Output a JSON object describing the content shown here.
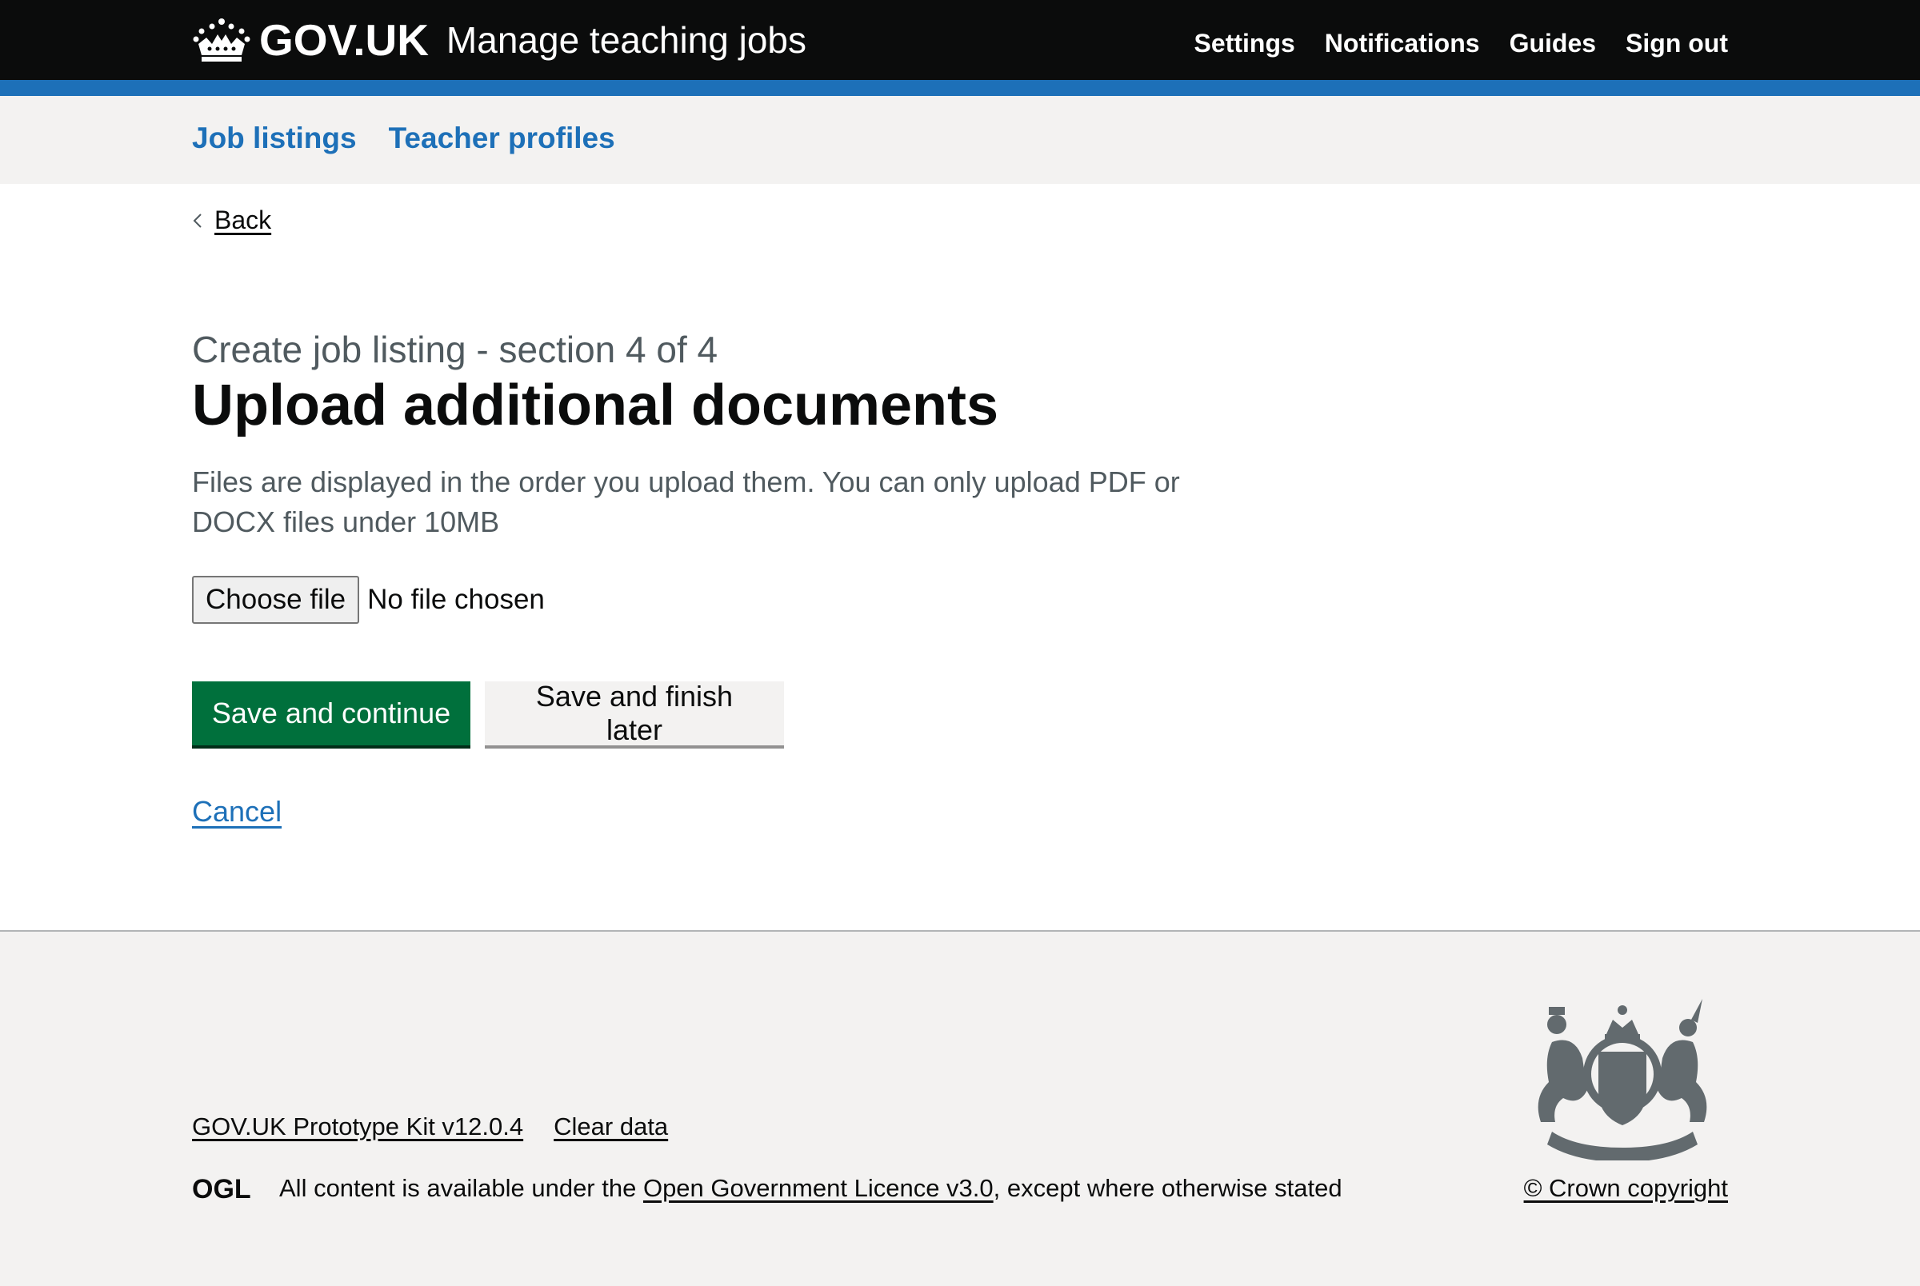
{
  "header": {
    "logo_text": "GOV.UK",
    "service_name": "Manage teaching jobs",
    "nav": [
      "Settings",
      "Notifications",
      "Guides",
      "Sign out"
    ]
  },
  "subnav": {
    "items": [
      "Job listings",
      "Teacher profiles"
    ]
  },
  "back_link": "Back",
  "form": {
    "caption": "Create job listing - section 4 of 4",
    "title": "Upload additional documents",
    "hint": "Files are displayed in the order you upload them. You can only upload PDF or DOCX files under 10MB",
    "file_button": "Choose file",
    "file_status": "No file chosen",
    "primary_button": "Save and continue",
    "secondary_button": "Save and finish later",
    "cancel_link": "Cancel"
  },
  "footer": {
    "links": [
      "GOV.UK Prototype Kit v12.0.4",
      "Clear data"
    ],
    "licence_prefix": "All content is available under the ",
    "licence_link": "Open Government Licence v3.0",
    "licence_suffix": ", except where otherwise stated",
    "copyright": "© Crown copyright",
    "ogl_logo": "OGL"
  },
  "colors": {
    "header_bg": "#0b0c0c",
    "brand_blue": "#1d70b8",
    "primary_green": "#00703c",
    "footer_bg": "#f3f2f1"
  }
}
